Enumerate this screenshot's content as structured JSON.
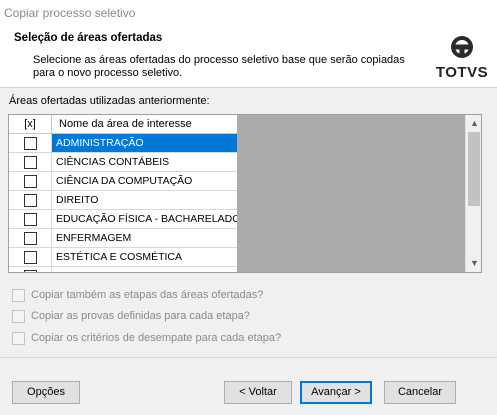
{
  "window": {
    "title": "Copiar processo seletivo"
  },
  "header": {
    "title": "Seleção de áreas ofertadas",
    "description": "Selecione as áreas ofertadas do processo seletivo base que serão copiadas para o novo processo seletivo.",
    "logo_text": "TOTVS"
  },
  "list": {
    "label": "Áreas ofertadas utilizadas anteriormente:",
    "columns": {
      "check": "[x]",
      "name": "Nome da área de interesse"
    },
    "rows": [
      {
        "name": "ADMINISTRAÇÃO",
        "checked": false,
        "selected": true
      },
      {
        "name": "CIÊNCIAS CONTÁBEIS",
        "checked": false,
        "selected": false
      },
      {
        "name": "CIÊNCIA DA COMPUTAÇÃO",
        "checked": false,
        "selected": false
      },
      {
        "name": "DIREITO",
        "checked": false,
        "selected": false
      },
      {
        "name": "EDUCAÇÃO FÍSICA - BACHARELADO",
        "checked": false,
        "selected": false
      },
      {
        "name": "ENFERMAGEM",
        "checked": false,
        "selected": false
      },
      {
        "name": "ESTÉTICA E COSMÉTICA",
        "checked": false,
        "selected": false
      }
    ]
  },
  "options": [
    {
      "label": "Copiar também as etapas das áreas ofertadas?",
      "checked": false,
      "enabled": false
    },
    {
      "label": "Copiar as provas definidas para cada etapa?",
      "checked": false,
      "enabled": false
    },
    {
      "label": "Copiar os critérios de desempate para cada etapa?",
      "checked": false,
      "enabled": false
    }
  ],
  "buttons": {
    "options": "Opções",
    "back": "< Voltar",
    "next": "Avançar >",
    "cancel": "Cancelar"
  },
  "colors": {
    "selection": "#0078d7",
    "empty_grid": "#ababab",
    "disabled_text": "#8a8a8a"
  }
}
